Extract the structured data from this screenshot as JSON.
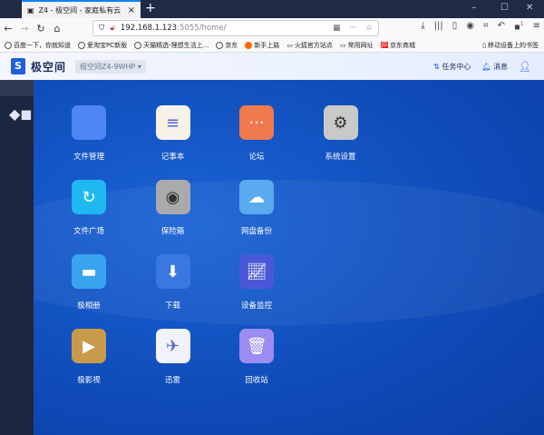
{
  "browser": {
    "tab_title": "Z4 - 极空间 - 家庭私有云",
    "url_host": "192.168.1.123",
    "url_port": ":5055",
    "url_path": "/home/",
    "bookmarks": [
      "百度一下，你就知道",
      "爱淘宝PC新版",
      "天猫精选-理想生活上...",
      "京东",
      "新手上路",
      "火狐官方站点",
      "常用网址",
      "京东商城"
    ],
    "mobile_bookmarks": "移动设备上的书签",
    "badge": "1"
  },
  "header": {
    "brand": "极空间",
    "device": "极空间Z4-9WHP",
    "tasks": "任务中心",
    "messages": "消息"
  },
  "apps": [
    {
      "label": "文件管理",
      "icon": "folder-icon",
      "color": "#4f86f5"
    },
    {
      "label": "记事本",
      "icon": "notepad-icon",
      "color": "#f6f2ea"
    },
    {
      "label": "论坛",
      "icon": "chat-bubbles-icon",
      "color": "#f07a4e"
    },
    {
      "label": "系统设置",
      "icon": "gear-icon",
      "color": "#c9c9c9"
    },
    {
      "label": "文件广场",
      "icon": "shared-folder-icon",
      "color": "#1fb8f0"
    },
    {
      "label": "保险箱",
      "icon": "safe-icon",
      "color": "#aaaaaa"
    },
    {
      "label": "网盘备份",
      "icon": "cloud-upload-icon",
      "color": "#5aaaf0"
    },
    {
      "label": "极相册",
      "icon": "photo-album-icon",
      "color": "#3aa3f0"
    },
    {
      "label": "下载",
      "icon": "globe-download-icon",
      "color": "#3a78e0"
    },
    {
      "label": "设备监控",
      "icon": "chart-monitor-icon",
      "color": "#4a58d8"
    },
    {
      "label": "极影视",
      "icon": "video-icon",
      "color": "#c99a4a"
    },
    {
      "label": "迅雷",
      "icon": "thunder-bird-icon",
      "color": "#f0f3fb"
    },
    {
      "label": "回收站",
      "icon": "trash-icon",
      "color": "#9b8cf0"
    }
  ]
}
